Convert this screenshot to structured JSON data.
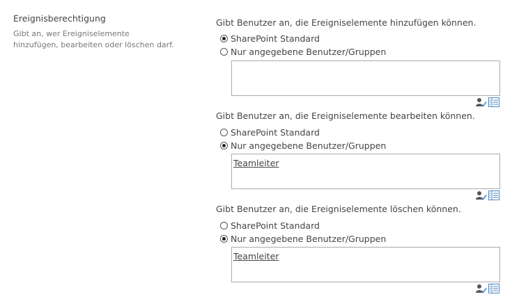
{
  "section": {
    "title": "Ereignisberechtigung",
    "description": "Gibt an, wer Ereigniselemente hinzufügen, bearbeiten oder löschen darf."
  },
  "groups": [
    {
      "title": "Gibt Benutzer an, die Ereigniselemente hinzufügen können.",
      "option_standard": "SharePoint Standard",
      "option_specific": "Nur angegebene Benutzer/Gruppen",
      "selected": "standard",
      "people_value": ""
    },
    {
      "title": "Gibt Benutzer an, die Ereigniselemente bearbeiten können.",
      "option_standard": "SharePoint Standard",
      "option_specific": "Nur angegebene Benutzer/Gruppen",
      "selected": "specific",
      "people_value": "Teamleiter"
    },
    {
      "title": "Gibt Benutzer an, die Ereigniselemente löschen können.",
      "option_standard": "SharePoint Standard",
      "option_specific": "Nur angegebene Benutzer/Gruppen",
      "selected": "specific",
      "people_value": "Teamleiter"
    }
  ],
  "icons": {
    "check_names": "check-names-icon",
    "browse": "address-book-icon"
  },
  "colors": {
    "text": "#444444",
    "muted": "#777777",
    "border": "#ababab",
    "icon_blue": "#4a86c5"
  }
}
